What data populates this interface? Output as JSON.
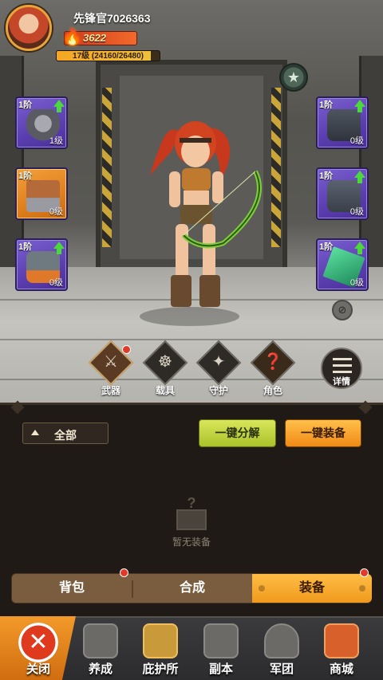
{
  "player": {
    "name": "先锋官7026363",
    "power": "3622",
    "level_text": "17级 (24160/26480)",
    "xp_progress": 0.912
  },
  "equipment_slots": {
    "left": [
      {
        "tier": "1阶",
        "level": "1级",
        "upgradable": true,
        "rarity": "purple",
        "item": "helmet"
      },
      {
        "tier": "1阶",
        "level": "0级",
        "upgradable": false,
        "rarity": "orange",
        "item": "boots"
      },
      {
        "tier": "1阶",
        "level": "0级",
        "upgradable": true,
        "rarity": "purple",
        "item": "backpack"
      }
    ],
    "right": [
      {
        "tier": "1阶",
        "level": "0级",
        "upgradable": true,
        "rarity": "purple",
        "item": "vest"
      },
      {
        "tier": "1阶",
        "level": "0级",
        "upgradable": true,
        "rarity": "purple",
        "item": "armor"
      },
      {
        "tier": "1阶",
        "level": "0级",
        "upgradable": true,
        "rarity": "purple",
        "item": "crystal"
      }
    ]
  },
  "categories": [
    {
      "label": "武器",
      "icon": "weapon-icon",
      "active": true,
      "badge": true
    },
    {
      "label": "载具",
      "icon": "steering-wheel-icon",
      "active": false,
      "badge": false
    },
    {
      "label": "守护",
      "icon": "guardian-icon",
      "active": false,
      "badge": false
    },
    {
      "label": "角色",
      "icon": "shirt-icon",
      "active": false,
      "badge": false
    }
  ],
  "details_label": "详情",
  "filter": {
    "label": "全部"
  },
  "actions": {
    "dismantle": "一键分解",
    "equip": "一键装备"
  },
  "empty_state": {
    "text": "暂无装备"
  },
  "subtabs": [
    {
      "label": "背包",
      "badge": true,
      "active": false
    },
    {
      "label": "合成",
      "badge": false,
      "active": false
    },
    {
      "label": "装备",
      "badge": true,
      "active": true
    }
  ],
  "bottom_nav": [
    {
      "label": "关闭",
      "icon": "close-icon"
    },
    {
      "label": "养成",
      "icon": "fist-icon"
    },
    {
      "label": "庇护所",
      "icon": "building-icon"
    },
    {
      "label": "副本",
      "icon": "gun-icon"
    },
    {
      "label": "军团",
      "icon": "legion-emblem-icon"
    },
    {
      "label": "商城",
      "icon": "shopping-cart-icon"
    }
  ],
  "colors": {
    "accent_orange": "#f09a1d",
    "accent_green": "#aac22a",
    "slot_purple": "#5b3fb0",
    "slot_orange": "#e0801e"
  }
}
